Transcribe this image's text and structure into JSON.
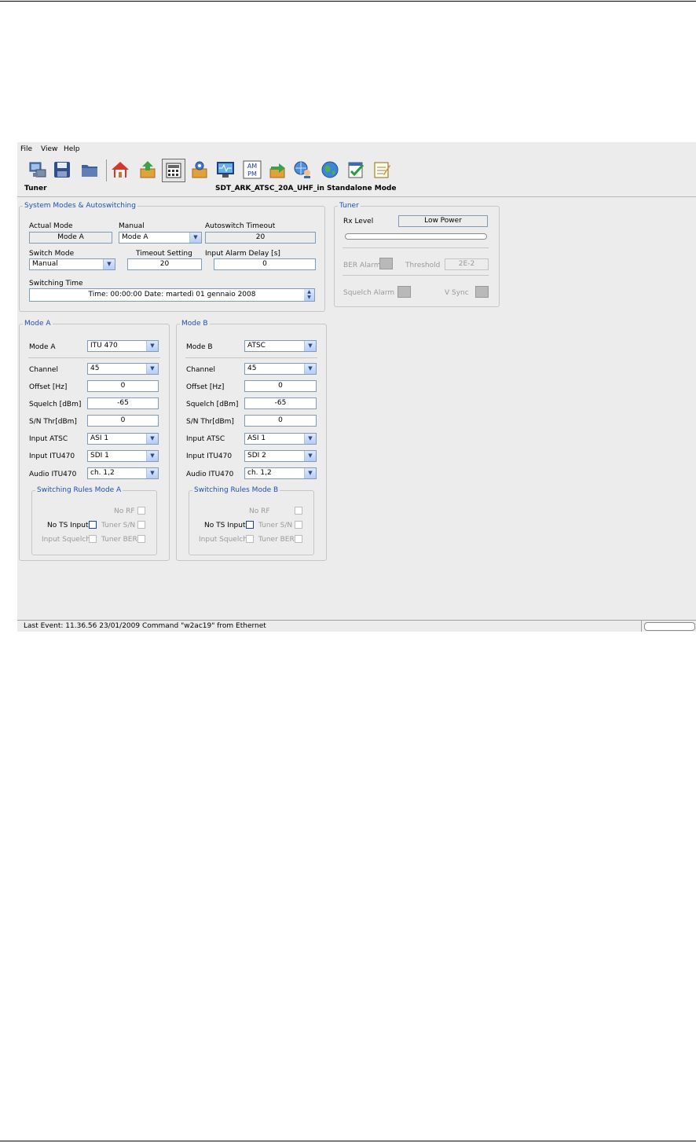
{
  "menu": [
    "File",
    "View",
    "Help"
  ],
  "toolbar_icons": [
    "computer-icon",
    "save-icon",
    "folder-icon",
    "home-icon",
    "box-up-icon",
    "keypad-icon",
    "gear-box-icon",
    "monitor-icon",
    "am-pm-icon",
    "box-arrow-icon",
    "globe-user-icon",
    "world-icon",
    "checklist-icon",
    "notepad-icon"
  ],
  "ampm": {
    "am": "AM",
    "pm": "PM"
  },
  "header": {
    "section": "Tuner",
    "device": "SDT_ARK_ATSC_20A_UHF_in Standalone Mode"
  },
  "system": {
    "legend": "System Modes & Autoswitching",
    "actual_mode_label": "Actual Mode",
    "actual_mode_value": "Mode A",
    "manual_label": "Manual",
    "manual_value": "Mode A",
    "autoswitch_label": "Autoswitch Timeout",
    "autoswitch_value": "20",
    "switch_mode_label": "Switch Mode",
    "switch_mode_value": "Manual",
    "timeout_label": "Timeout Setting",
    "timeout_value": "20",
    "alarm_delay_label": "Input Alarm Delay [s]",
    "alarm_delay_value": "0",
    "switching_time_label": "Switching Time",
    "switching_time_value": "Time: 00:00:00   Date: martedì 01 gennaio 2008"
  },
  "tuner": {
    "legend": "Tuner",
    "rx_label": "Rx Level",
    "rx_value": "Low Power",
    "rx_level_fraction": 0,
    "ber_label": "BER Alarm",
    "threshold_label": "Threshold",
    "threshold_value": "2E-2",
    "squelch_label": "Squelch Alarm",
    "vsync_label": "V Sync"
  },
  "labels": {
    "channel": "Channel",
    "offset": "Offset [Hz]",
    "squelch": "Squelch [dBm]",
    "sn": "S/N Thr[dBm]",
    "input_atsc": "Input ATSC",
    "input_itu": "Input ITU470",
    "audio_itu": "Audio ITU470",
    "no_rf": "No RF",
    "no_ts": "No TS Input",
    "tuner_sn": "Tuner S/N",
    "input_squelch": "Input Squelch",
    "tuner_ber": "Tuner BER"
  },
  "modeA": {
    "legend": "Mode A",
    "mode_label": "Mode A",
    "mode_value": "ITU 470",
    "channel": "45",
    "offset": "0",
    "squelch": "-65",
    "sn": "0",
    "input_atsc": "ASI 1",
    "input_itu": "SDI 1",
    "audio_itu": "ch. 1,2",
    "rules_legend": "Switching Rules Mode A"
  },
  "modeB": {
    "legend": "Mode B",
    "mode_label": "Mode B",
    "mode_value": "ATSC",
    "channel": "45",
    "offset": "0",
    "squelch": "-65",
    "sn": "0",
    "input_atsc": "ASI 1",
    "input_itu": "SDI 2",
    "audio_itu": "ch. 1,2",
    "rules_legend": "Switching Rules Mode B"
  },
  "status": {
    "last_event": "Last Event: 11.36.56   23/01/2009 Command \"w2ac19\" from Ethernet"
  }
}
